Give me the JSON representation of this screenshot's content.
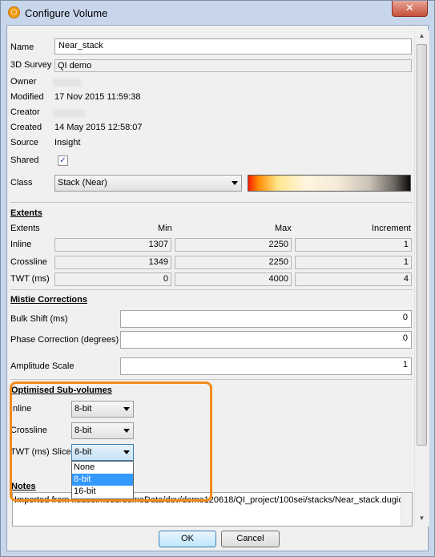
{
  "window": {
    "title": "Configure Volume",
    "close_glyph": "✕"
  },
  "general": {
    "name_label": "Name",
    "name_value": "Near_stack",
    "survey_label": "3D Survey",
    "survey_value": "QI demo",
    "owner_label": "Owner",
    "modified_label": "Modified",
    "modified_value": "17 Nov 2015 11:59:38",
    "creator_label": "Creator",
    "created_label": "Created",
    "created_value": "14 May 2015 12:58:07",
    "source_label": "Source",
    "source_value": "Insight",
    "shared_label": "Shared",
    "shared_checked": true,
    "class_label": "Class",
    "class_value": "Stack (Near)"
  },
  "extents": {
    "title": "Extents",
    "col_header": "Extents",
    "min_header": "Min",
    "max_header": "Max",
    "inc_header": "Increment",
    "rows": [
      {
        "label": "Inline",
        "min": "1307",
        "max": "2250",
        "inc": "1"
      },
      {
        "label": "Crossline",
        "min": "1349",
        "max": "2250",
        "inc": "1"
      },
      {
        "label": "TWT (ms)",
        "min": "0",
        "max": "4000",
        "inc": "4"
      }
    ]
  },
  "mistie": {
    "title": "Mistie Corrections",
    "bulk_label": "Bulk Shift (ms)",
    "bulk_value": "0",
    "phase_label": "Phase Correction (degrees)",
    "phase_value": "0",
    "amp_label": "Amplitude Scale",
    "amp_value": "1"
  },
  "subvolumes": {
    "title": "Optimised Sub-volumes",
    "inline_label": "Inline",
    "inline_value": "8-bit",
    "crossline_label": "Crossline",
    "crossline_value": "8-bit",
    "twt_label": "TWT (ms) Slice",
    "twt_value": "8-bit",
    "options": [
      "None",
      "8-bit",
      "16-bit"
    ],
    "selected_option": "8-bit"
  },
  "notes": {
    "title": "Notes",
    "text": "Imported from kudos:/node/demoData/dev/demo120618/QI_project/100sei/stacks/Near_stack.dugio"
  },
  "buttons": {
    "ok_label": "OK",
    "cancel_label": "Cancel"
  },
  "colors": {
    "highlight": "#f28a1b",
    "selection": "#3399ff"
  }
}
